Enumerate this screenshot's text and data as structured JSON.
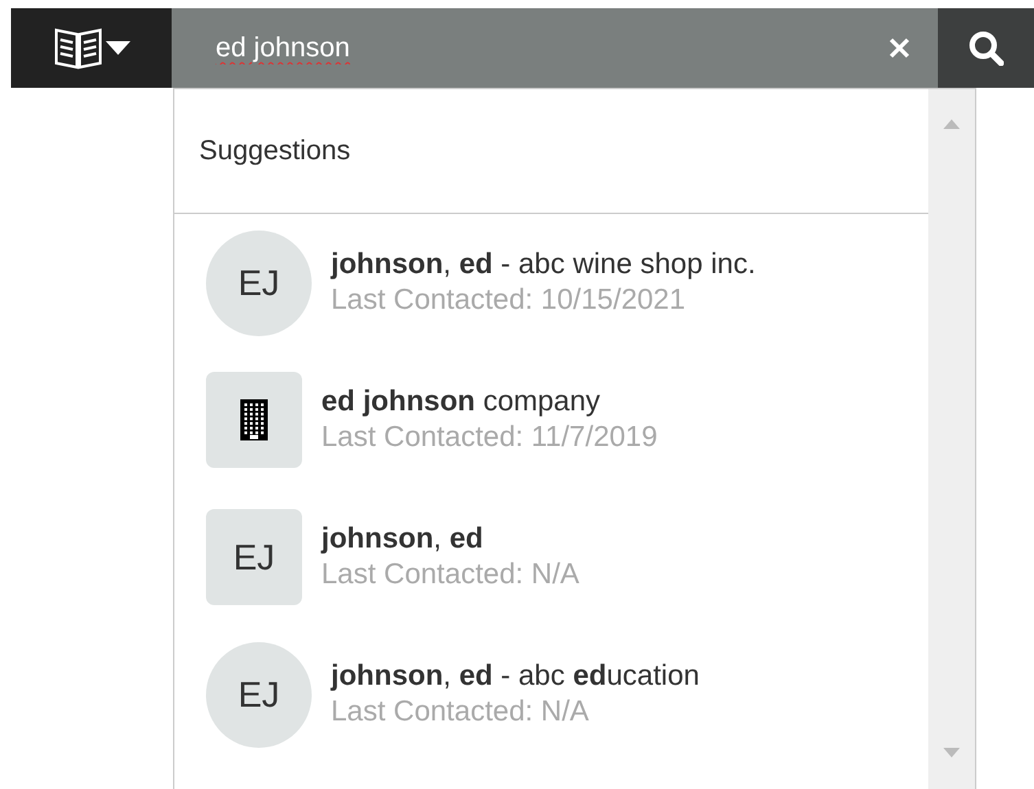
{
  "search": {
    "value": "ed johnson"
  },
  "dropdown": {
    "heading": "Suggestions",
    "items": [
      {
        "kind": "person",
        "initials": "EJ",
        "title": "**johnson**, **ed** - abc wine shop inc.",
        "subtitle": "Last Contacted: 10/15/2021"
      },
      {
        "kind": "company",
        "title": "**ed johnson** company",
        "subtitle": "Last Contacted: 11/7/2019"
      },
      {
        "kind": "contact",
        "initials": "EJ",
        "title": "**johnson**, **ed**",
        "subtitle": "Last Contacted: N/A"
      },
      {
        "kind": "person",
        "initials": "EJ",
        "title": "**johnson**, **ed** - abc **ed**ucation",
        "subtitle": "Last Contacted: N/A"
      }
    ]
  }
}
